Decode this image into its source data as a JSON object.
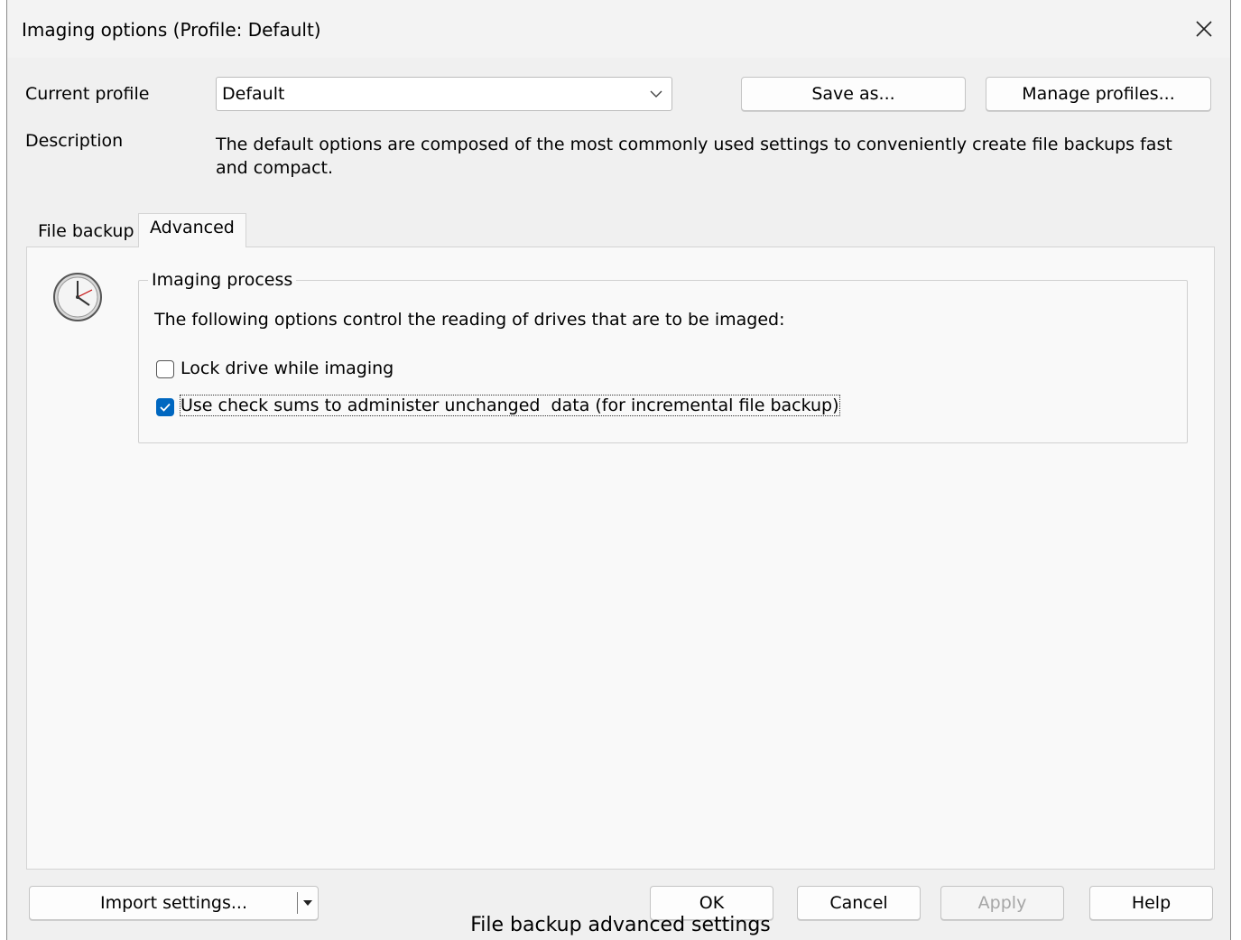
{
  "window": {
    "title": "Imaging options (Profile: Default)",
    "close_icon": "close-icon"
  },
  "profile": {
    "label": "Current profile",
    "value": "Default",
    "save_as_label": "Save as...",
    "manage_label": "Manage profiles...",
    "description_label": "Description",
    "description_text": "The default options are composed of the most commonly used settings to conveniently create file backups fast and compact."
  },
  "tabs": [
    {
      "label": "File backup",
      "active": false
    },
    {
      "label": "Advanced",
      "active": true
    }
  ],
  "advanced": {
    "icon": "clock-icon",
    "group_title": "Imaging process",
    "intro": "The following options control the reading of drives that are to be imaged:",
    "options": [
      {
        "label": "Lock drive while imaging",
        "checked": false
      },
      {
        "label": "Use check sums to administer unchanged  data (for incremental file backup)",
        "checked": true
      }
    ]
  },
  "footer": {
    "import_label": "Import settings...",
    "ok_label": "OK",
    "cancel_label": "Cancel",
    "apply_label": "Apply",
    "help_label": "Help"
  },
  "caption": "File backup advanced settings",
  "colors": {
    "accent": "#0067c0",
    "disabled_text": "#a6a6a6"
  }
}
